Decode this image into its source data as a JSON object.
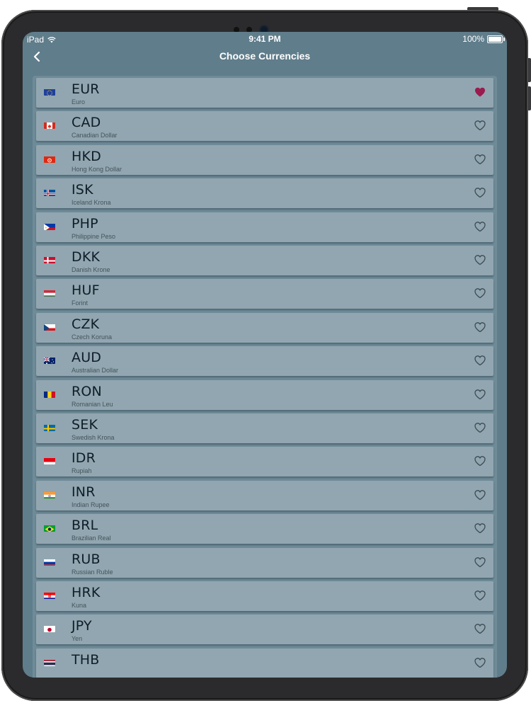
{
  "status_bar": {
    "carrier": "iPad",
    "time": "9:41 PM",
    "battery": "100%",
    "battery_level": 1.0
  },
  "nav": {
    "title": "Choose Currencies",
    "back_icon": "chevron-left-icon"
  },
  "colors": {
    "screen_bg": "#607d8b",
    "row_bg": "#91a6b0",
    "favorite_heart": "#9b1b4e",
    "outline_heart": "#3b4a52"
  },
  "currencies": [
    {
      "code": "EUR",
      "name": "Euro",
      "flag": "eu",
      "favorite": true
    },
    {
      "code": "CAD",
      "name": "Canadian Dollar",
      "flag": "ca",
      "favorite": false
    },
    {
      "code": "HKD",
      "name": "Hong Kong Dollar",
      "flag": "hk",
      "favorite": false
    },
    {
      "code": "ISK",
      "name": "Iceland Krona",
      "flag": "is",
      "favorite": false
    },
    {
      "code": "PHP",
      "name": "Philippine Peso",
      "flag": "ph",
      "favorite": false
    },
    {
      "code": "DKK",
      "name": "Danish Krone",
      "flag": "dk",
      "favorite": false
    },
    {
      "code": "HUF",
      "name": "Forint",
      "flag": "hu",
      "favorite": false
    },
    {
      "code": "CZK",
      "name": "Czech Koruna",
      "flag": "cz",
      "favorite": false
    },
    {
      "code": "AUD",
      "name": "Australian Dollar",
      "flag": "au",
      "favorite": false
    },
    {
      "code": "RON",
      "name": "Romanian Leu",
      "flag": "ro",
      "favorite": false
    },
    {
      "code": "SEK",
      "name": "Swedish Krona",
      "flag": "se",
      "favorite": false
    },
    {
      "code": "IDR",
      "name": "Rupiah",
      "flag": "id",
      "favorite": false
    },
    {
      "code": "INR",
      "name": "Indian Rupee",
      "flag": "in",
      "favorite": false
    },
    {
      "code": "BRL",
      "name": "Brazilian Real",
      "flag": "br",
      "favorite": false
    },
    {
      "code": "RUB",
      "name": "Russian Ruble",
      "flag": "ru",
      "favorite": false
    },
    {
      "code": "HRK",
      "name": "Kuna",
      "flag": "hr",
      "favorite": false
    },
    {
      "code": "JPY",
      "name": "Yen",
      "flag": "jp",
      "favorite": false
    },
    {
      "code": "THB",
      "name": "",
      "flag": "th",
      "favorite": false
    }
  ]
}
